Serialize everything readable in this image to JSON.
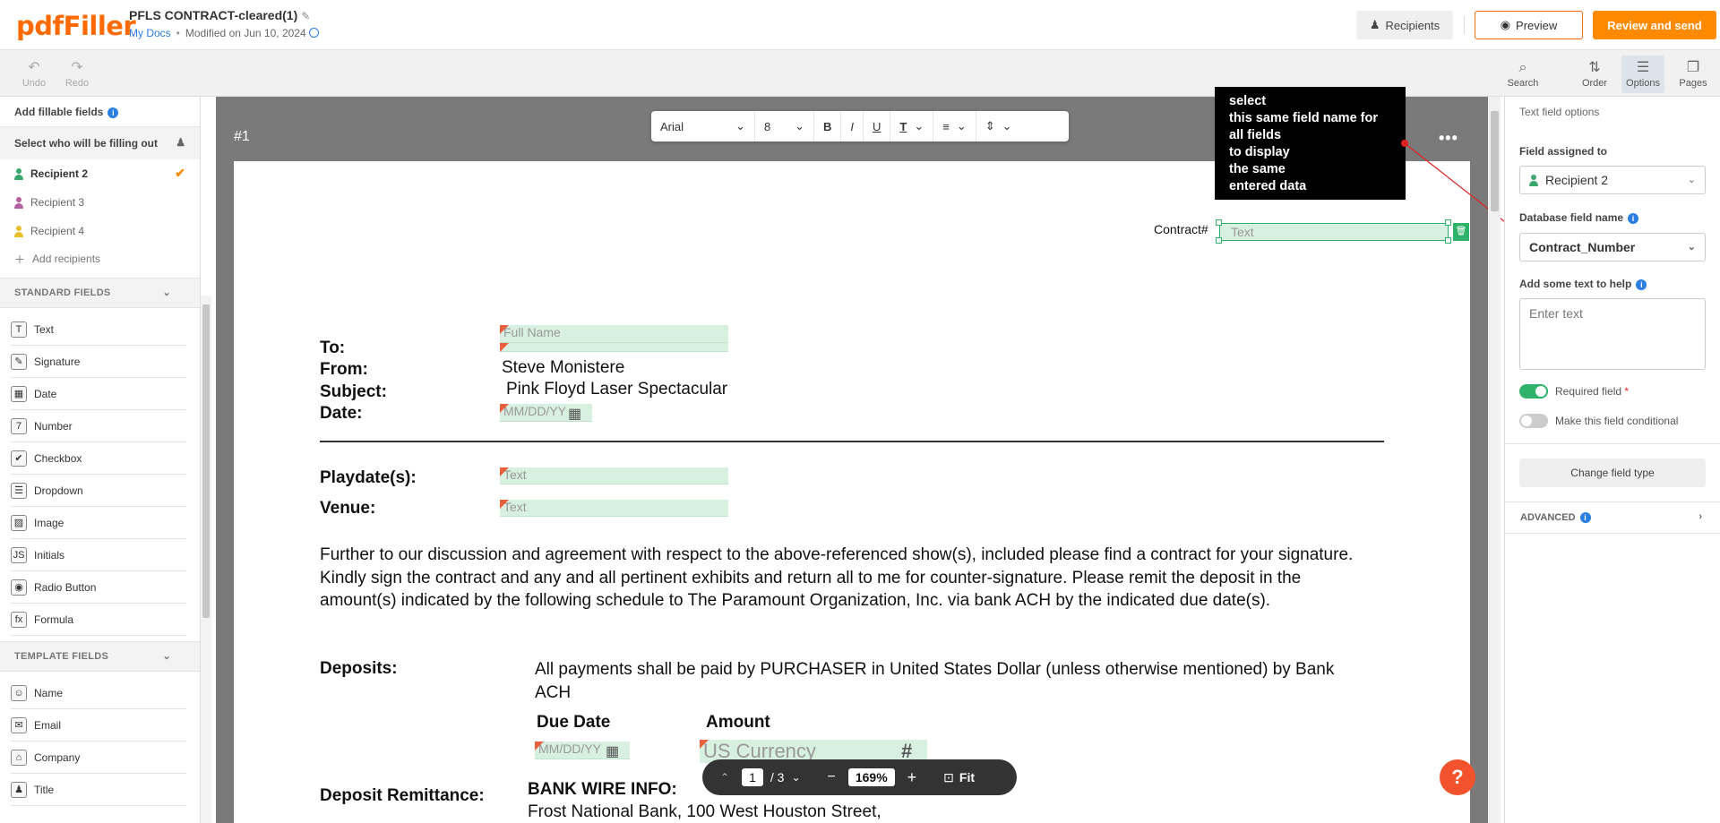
{
  "app": {
    "logo": "pdfFiller",
    "doc_title": "PFLS CONTRACT-cleared(1)",
    "location": "My Docs",
    "modified": "Modified on Jun 10, 2024"
  },
  "header": {
    "recipients": "Recipients",
    "preview": "Preview",
    "review": "Review and send"
  },
  "toolbar": {
    "undo": "Undo",
    "redo": "Redo",
    "search": "Search",
    "order": "Order",
    "options": "Options",
    "pages": "Pages"
  },
  "sidebar": {
    "add_fillable": "Add fillable fields",
    "select_who": "Select who will be filling out",
    "recipients": [
      {
        "label": "Recipient 2",
        "color": "#3aa76d",
        "selected": true
      },
      {
        "label": "Recipient 3",
        "color": "#b45fa0",
        "selected": false
      },
      {
        "label": "Recipient 4",
        "color": "#e8c02b",
        "selected": false
      }
    ],
    "add_recipients": "Add recipients",
    "standard_header": "STANDARD FIELDS",
    "standard": [
      {
        "label": "Text",
        "icon": "T"
      },
      {
        "label": "Signature",
        "icon": "✎"
      },
      {
        "label": "Date",
        "icon": "▦"
      },
      {
        "label": "Number",
        "icon": "7"
      },
      {
        "label": "Checkbox",
        "icon": "✔"
      },
      {
        "label": "Dropdown",
        "icon": "☰"
      },
      {
        "label": "Image",
        "icon": "▨"
      },
      {
        "label": "Initials",
        "icon": "JS"
      },
      {
        "label": "Radio Button",
        "icon": "◉"
      },
      {
        "label": "Formula",
        "icon": "fx"
      }
    ],
    "template_header": "TEMPLATE FIELDS",
    "template": [
      {
        "label": "Name",
        "icon": "☺"
      },
      {
        "label": "Email",
        "icon": "✉"
      },
      {
        "label": "Company",
        "icon": "⌂"
      },
      {
        "label": "Title",
        "icon": "♟"
      }
    ]
  },
  "canvas": {
    "page_label": "#1",
    "more": "•••"
  },
  "format_bar": {
    "font": "Arial",
    "size": "8",
    "bold": "B",
    "italic": "I",
    "underline": "U",
    "color": "T"
  },
  "note": {
    "lines": [
      "select",
      "this same field name for",
      "all fields",
      "to display",
      "the same",
      "entered data"
    ]
  },
  "document": {
    "contract_label": "Contract#",
    "contract_field": "Text",
    "to": "To:",
    "from": "From:",
    "subject": "Subject:",
    "date": "Date:",
    "to_value": "Full Name",
    "from_value": "Steve Monistere",
    "subject_value": "Pink Floyd Laser Spectacular",
    "date_value": "MM/DD/YY",
    "playdates": "Playdate(s):",
    "playdates_value": "Text",
    "venue": "Venue:",
    "venue_value": "Text",
    "paragraph": "Further to our discussion and agreement with respect to the above-referenced show(s), included please find a contract for your signature. Kindly sign  the contract and any and all pertinent exhibits and return all to me for counter-signature. Please remit the deposit in the amount(s) indicated by the following schedule to The Paramount Organization, Inc. via bank ACH by the indicated due date(s).",
    "deposits": "Deposits:",
    "deposits_text": "All payments shall be paid by PURCHASER in United States Dollar (unless otherwise mentioned) by Bank ACH",
    "due_date": "Due Date",
    "amount": "Amount",
    "due_date_value": "MM/DD/YY",
    "amount_value": "US Currency",
    "remit": "Deposit Remittance:",
    "bank_wire": "BANK WIRE INFO:",
    "bank_address": "Frost National Bank, 100 West Houston Street,"
  },
  "pager": {
    "page": "1",
    "total": "/ 3",
    "zoom": "169%",
    "fit": "Fit"
  },
  "right_panel": {
    "title": "Text field options",
    "assigned_label": "Field assigned to",
    "assigned_value": "Recipient 2",
    "db_label": "Database field name",
    "db_value": "Contract_Number",
    "help_label": "Add some text to help",
    "help_placeholder": "Enter text",
    "required": "Required field",
    "required_mark": "*",
    "conditional": "Make this field conditional",
    "change_type": "Change field type",
    "advanced": "ADVANCED"
  },
  "colors": {
    "brand": "#ff6a00",
    "accent_green": "#2fb36b",
    "link": "#2a7de1"
  }
}
